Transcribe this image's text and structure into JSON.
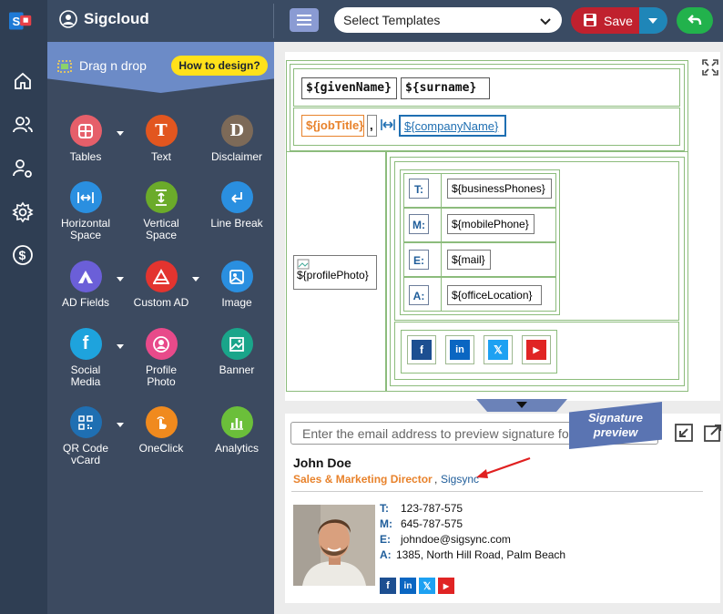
{
  "app": {
    "brand": "Sigcloud"
  },
  "toolbar": {
    "template_select": "Select Templates",
    "save_label": "Save"
  },
  "panel": {
    "header": "Drag n drop",
    "help_button": "How to design?",
    "tools": [
      {
        "label": "Tables",
        "icon": "table-icon",
        "color": "#e65f6a",
        "dropdown": true
      },
      {
        "label": "Text",
        "icon": "text-icon",
        "color": "#e2561f",
        "glyph": "T",
        "dropdown": false
      },
      {
        "label": "Disclaimer",
        "icon": "disclaimer-icon",
        "color": "#7d6a58",
        "glyph": "D",
        "dropdown": false
      },
      {
        "label": "Horizontal Space",
        "icon": "horizontal-space-icon",
        "color": "#2a8fe0",
        "dropdown": false
      },
      {
        "label": "Vertical Space",
        "icon": "vertical-space-icon",
        "color": "#6bab2a",
        "dropdown": false
      },
      {
        "label": "Line Break",
        "icon": "line-break-icon",
        "color": "#2a8fe0",
        "dropdown": false
      },
      {
        "label": "AD Fields",
        "icon": "ad-fields-icon",
        "color": "#6b5fd8",
        "dropdown": true
      },
      {
        "label": "Custom AD",
        "icon": "custom-ad-icon",
        "color": "#e3342f",
        "dropdown": true
      },
      {
        "label": "Image",
        "icon": "image-icon",
        "color": "#2a8fe0",
        "dropdown": false
      },
      {
        "label": "Social Media",
        "icon": "social-media-icon",
        "color": "#1ea3dd",
        "dropdown": true
      },
      {
        "label": "Profile Photo",
        "icon": "profile-photo-icon",
        "color": "#e84a8a",
        "dropdown": false
      },
      {
        "label": "Banner",
        "icon": "banner-icon",
        "color": "#1aa58a",
        "dropdown": false
      },
      {
        "label": "QR Code vCard",
        "icon": "qr-code-icon",
        "color": "#1f6fb2",
        "dropdown": true
      },
      {
        "label": "OneClick",
        "icon": "oneclick-icon",
        "color": "#f08a1e",
        "dropdown": false
      },
      {
        "label": "Analytics",
        "icon": "analytics-icon",
        "color": "#6bbf3a",
        "dropdown": false
      }
    ]
  },
  "canvas": {
    "given_name": "${givenName}",
    "surname": "${surname}",
    "job_title": "${jobTitle}",
    "separator": ",",
    "company_name": "${companyName}",
    "profile_photo": "${profilePhoto}",
    "contacts": [
      {
        "label": "T:",
        "value": "${businessPhones}"
      },
      {
        "label": "M:",
        "value": "${mobilePhone}"
      },
      {
        "label": "E:",
        "value": "${mail}"
      },
      {
        "label": "A:",
        "value": "${officeLocation}"
      }
    ],
    "social_colors": {
      "facebook": "#1d4f91",
      "linkedin": "#0a66c2",
      "x": "#1da1f2",
      "youtube": "#e02424"
    }
  },
  "preview": {
    "email_placeholder": "Enter the email address to preview signature for",
    "badge": "Signature preview",
    "name": "John Doe",
    "title": "Sales & Marketing Director",
    "comma": ",",
    "company": "Sigsync",
    "contacts": [
      {
        "label": "T:",
        "value": "123-787-575"
      },
      {
        "label": "M:",
        "value": "645-787-575"
      },
      {
        "label": "E:",
        "value": "johndoe@sigsync.com"
      },
      {
        "label": "A:",
        "value": "1385, North Hill Road, Palm Beach"
      }
    ]
  }
}
